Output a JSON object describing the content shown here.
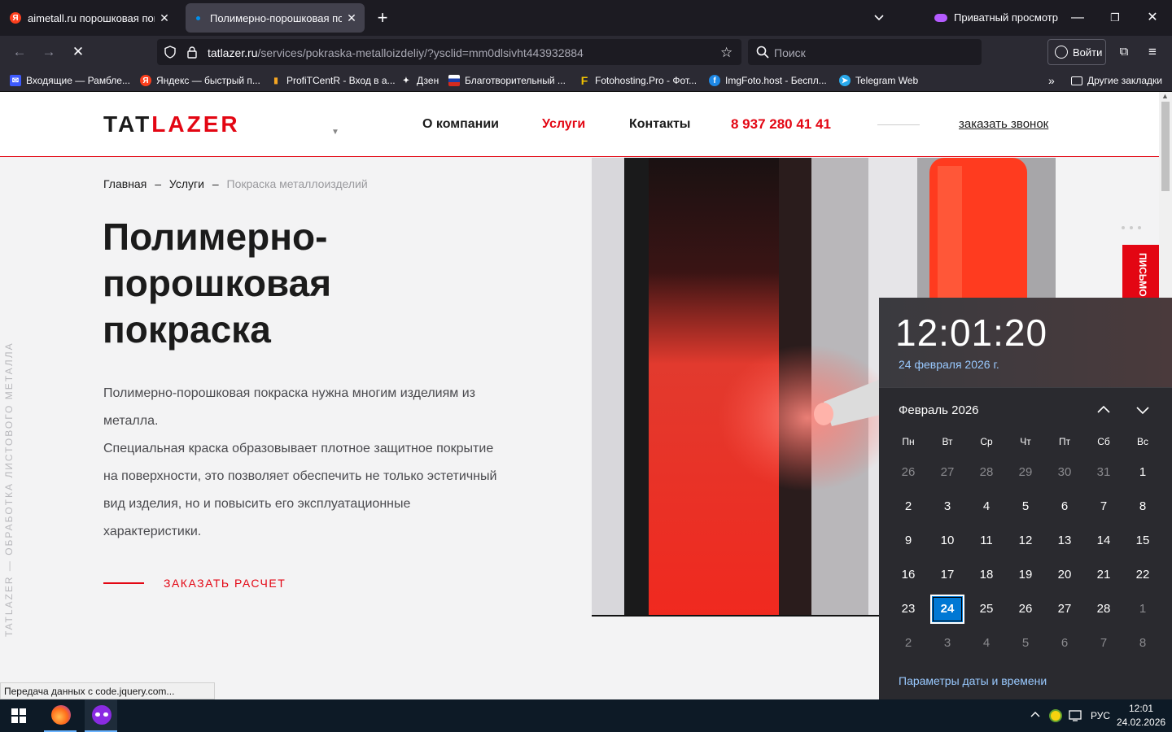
{
  "browser": {
    "tabs": [
      {
        "title": "aimetall.ru порошковая покра",
        "favicon": "yandex-icon",
        "active": false
      },
      {
        "title": "Полимерно-порошковая покр",
        "favicon": "dot-icon",
        "active": true
      }
    ],
    "new_tab_label": "+",
    "private_label": "Приватный просмотр",
    "url_host": "tatlazer.ru",
    "url_path": "/services/pokraska-metalloizdeliy/?ysclid=mm0dlsivht443932884",
    "search_placeholder": "Поиск",
    "signin_label": "Войти",
    "bookmarks": [
      {
        "label": "Входящие — Рамбле...",
        "icon": "mail-icon",
        "color": "#3d5afe"
      },
      {
        "label": "Яндекс — быстрый п...",
        "icon": "yandex-icon",
        "color": "#fc3f1d"
      },
      {
        "label": "ProfiTCentR - Вход в а...",
        "icon": "chart-icon",
        "color": "#f5a623"
      },
      {
        "label": "Дзен",
        "icon": "zen-icon",
        "color": "#ffffff"
      },
      {
        "label": "Благотворительный ...",
        "icon": "flag-icon",
        "color": "#d52b1e"
      },
      {
        "label": "Fotohosting.Pro - Фот...",
        "icon": "f-icon",
        "color": "#f5c400"
      },
      {
        "label": "ImgFoto.host - Беспл...",
        "icon": "imgfoto-icon",
        "color": "#1e88e5"
      },
      {
        "label": "Telegram Web",
        "icon": "telegram-icon",
        "color": "#29a9eb"
      }
    ],
    "other_bookmarks": "Другие закладки",
    "status_text": "Передача данных с code.jquery.com..."
  },
  "site": {
    "logo_a": "TAT",
    "logo_b": "LAZER",
    "nav": [
      "О компании",
      "Услуги",
      "Контакты"
    ],
    "phone": "8 937 280 41 41",
    "callback": "заказать звонок",
    "breadcrumb": {
      "home": "Главная",
      "sep": "–",
      "services": "Услуги",
      "current": "Покраска металлоизделий"
    },
    "title_lines": [
      "Полимерно-",
      "порошковая",
      "покраска"
    ],
    "paragraphs": [
      "Полимерно-порошковая покраска нужна многим изделиям из металла.",
      "Специальная краска образовывает плотное защитное покрытие на поверхности, это позволяет обеспечить не только эстетичный вид изделия, но и повысить его эксплуатационные характеристики."
    ],
    "cta": "ЗАКАЗАТЬ РАСЧЕТ",
    "vertical_text": "TATLAZER — ОБРАБОТКА ЛИСТОВОГО МЕТАЛЛА",
    "side_tab": "ПИСЬМО ДИРЕКТОРУ",
    "accent": "#e30613"
  },
  "calendar": {
    "time": "12:01:20",
    "date_long": "24 февраля 2026 г.",
    "month": "Февраль 2026",
    "weekdays": [
      "Пн",
      "Вт",
      "Ср",
      "Чт",
      "Пт",
      "Сб",
      "Вс"
    ],
    "weeks": [
      [
        [
          "26",
          1
        ],
        [
          "27",
          1
        ],
        [
          "28",
          1
        ],
        [
          "29",
          1
        ],
        [
          "30",
          1
        ],
        [
          "31",
          1
        ],
        [
          "1",
          0
        ]
      ],
      [
        [
          "2",
          0
        ],
        [
          "3",
          0
        ],
        [
          "4",
          0
        ],
        [
          "5",
          0
        ],
        [
          "6",
          0
        ],
        [
          "7",
          0
        ],
        [
          "8",
          0
        ]
      ],
      [
        [
          "9",
          0
        ],
        [
          "10",
          0
        ],
        [
          "11",
          0
        ],
        [
          "12",
          0
        ],
        [
          "13",
          0
        ],
        [
          "14",
          0
        ],
        [
          "15",
          0
        ]
      ],
      [
        [
          "16",
          0
        ],
        [
          "17",
          0
        ],
        [
          "18",
          0
        ],
        [
          "19",
          0
        ],
        [
          "20",
          0
        ],
        [
          "21",
          0
        ],
        [
          "22",
          0
        ]
      ],
      [
        [
          "23",
          0
        ],
        [
          "24",
          2
        ],
        [
          "25",
          0
        ],
        [
          "26",
          0
        ],
        [
          "27",
          0
        ],
        [
          "28",
          0
        ],
        [
          "1",
          1
        ]
      ],
      [
        [
          "2",
          1
        ],
        [
          "3",
          1
        ],
        [
          "4",
          1
        ],
        [
          "5",
          1
        ],
        [
          "6",
          1
        ],
        [
          "7",
          1
        ],
        [
          "8",
          1
        ]
      ]
    ],
    "settings_link": "Параметры даты и времени",
    "accent": "#0078d4"
  },
  "taskbar": {
    "lang": "РУС",
    "clock_time": "12:01",
    "clock_date": "24.02.2026"
  }
}
